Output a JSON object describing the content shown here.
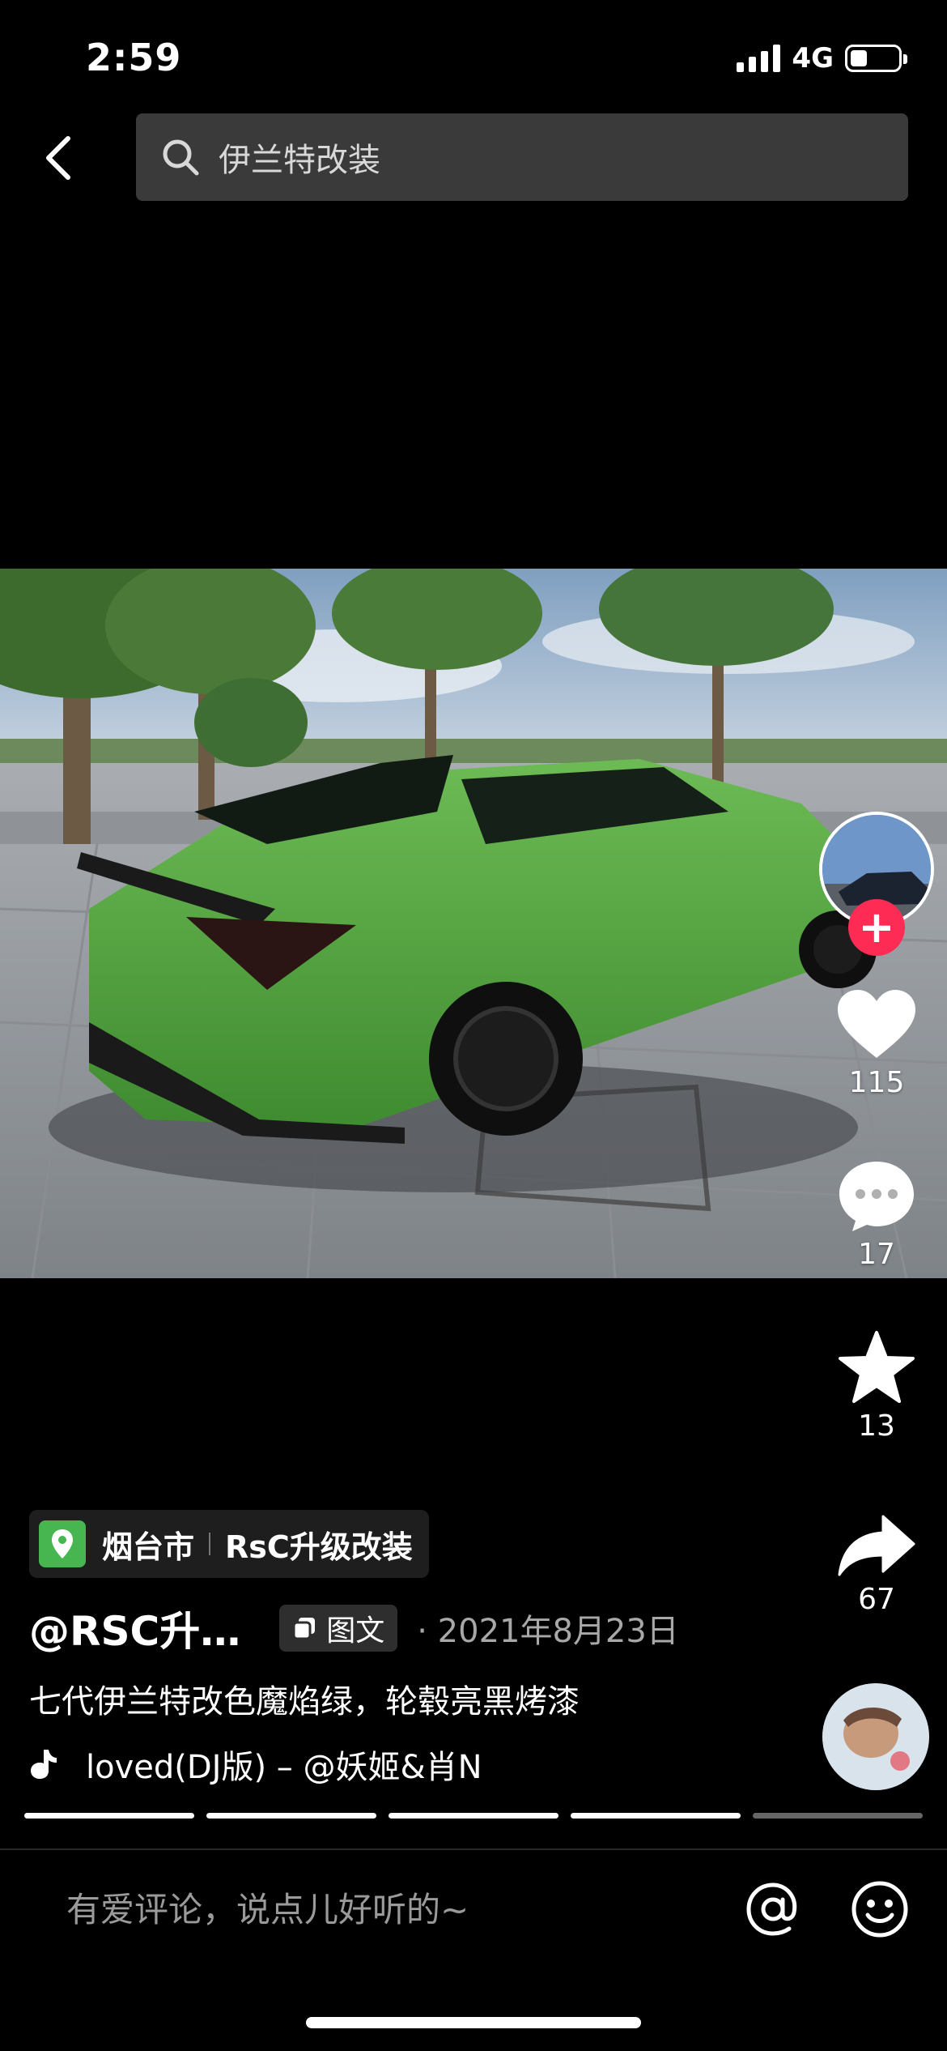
{
  "status_bar": {
    "time": "2:59",
    "network": "4G",
    "battery_level": 0.35
  },
  "search": {
    "query": "伊兰特改装"
  },
  "actions": {
    "likes": "115",
    "comments": "17",
    "favorites": "13",
    "shares": "67"
  },
  "post": {
    "location_city": "烟台市",
    "location_shop": "RsC升级改装",
    "author": "@RSC升…",
    "type_badge": "图文",
    "date": "· 2021年8月23日",
    "caption": "七代伊兰特改色魔焰绿，轮毂亮黑烤漆",
    "music": "loved(DJ版) – @妖姬&肖N"
  },
  "progress": {
    "total": 5,
    "active": 4
  },
  "comment_bar": {
    "placeholder": "有爱评论，说点儿好听的~"
  },
  "colors": {
    "follow": "#fe2c55",
    "location_pin": "#47b550",
    "search_bg": "#3a3a3a"
  }
}
